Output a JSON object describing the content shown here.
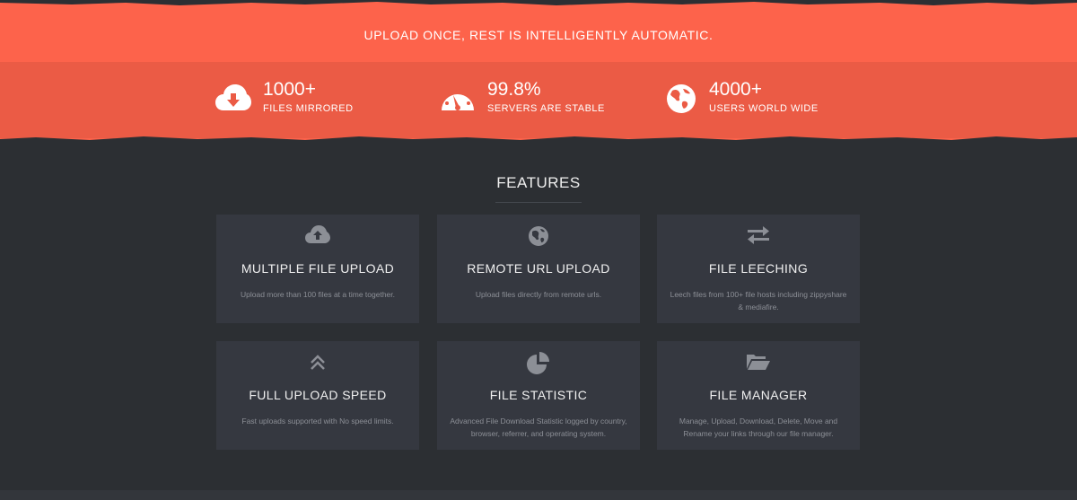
{
  "hero": {
    "tagline": "UPLOAD ONCE, REST IS INTELLIGENTLY AUTOMATIC.",
    "accent_color": "#fd634b",
    "band_color": "#eb5b45"
  },
  "stats": [
    {
      "icon": "cloud-download-icon",
      "value": "1000+",
      "label": "FILES MIRRORED"
    },
    {
      "icon": "speedometer-icon",
      "value": "99.8%",
      "label": "SERVERS ARE STABLE"
    },
    {
      "icon": "globe-icon",
      "value": "4000+",
      "label": "USERS WORLD WIDE"
    }
  ],
  "features": {
    "title": "FEATURES",
    "items": [
      {
        "icon": "cloud-upload-icon",
        "title": "MULTIPLE FILE UPLOAD",
        "desc": "Upload more than 100 files at a time together."
      },
      {
        "icon": "globe-icon",
        "title": "REMOTE URL UPLOAD",
        "desc": "Upload files directly from remote urls."
      },
      {
        "icon": "exchange-icon",
        "title": "FILE LEECHING",
        "desc": "Leech files from 100+ file hosts including zippyshare & mediafire."
      },
      {
        "icon": "double-chevron-up-icon",
        "title": "FULL UPLOAD SPEED",
        "desc": "Fast uploads supported with No speed limits."
      },
      {
        "icon": "pie-chart-icon",
        "title": "FILE STATISTIC",
        "desc": "Advanced File Download Statistic logged by country, browser, referrer, and operating system."
      },
      {
        "icon": "folder-open-icon",
        "title": "FILE MANAGER",
        "desc": "Manage, Upload, Download, Delete, Move and Rename your links through our file manager."
      }
    ]
  },
  "colors": {
    "background": "#2c2f33",
    "card": "#353840",
    "card_icon": "#8c8f96"
  }
}
